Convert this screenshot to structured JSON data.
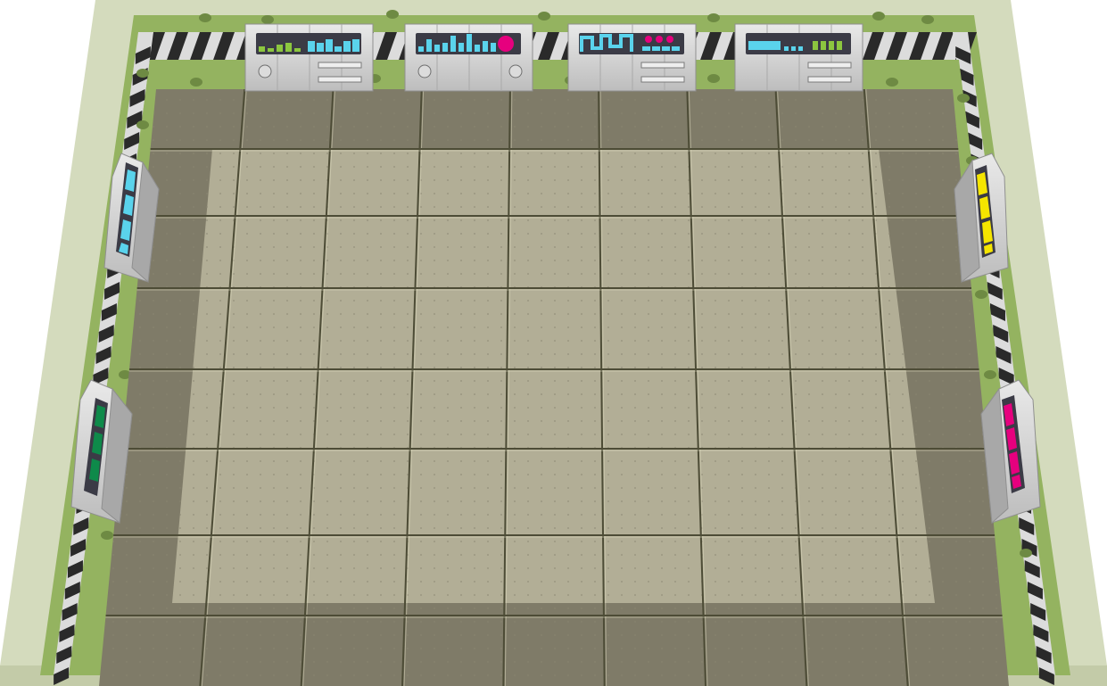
{
  "scene": {
    "kind": "top-down sci-fi game room",
    "grid": {
      "columns": 9,
      "rows": 7
    }
  },
  "colors": {
    "outer_wall": "#d4dbbd",
    "outer_wall_left_face": "#c3cba8",
    "wall_green": "#94b360",
    "wall_green_dark": "#7d9a4d",
    "wall_spot": "#6e8a43",
    "hazard_dark": "#2a2a2a",
    "hazard_light": "#dcdcdc",
    "floor_base": "#b2ae96",
    "floor_shadow": "#7f7b68",
    "floor_line": "#4d4c36",
    "floor_highlight": "#e3e0c3",
    "panel_body": "#d0d0d0",
    "panel_edge": "#8f8f8f",
    "screen_bg": "#3b3b46",
    "accent_green": "#8cc63f",
    "accent_cyan": "#5ad3ec",
    "accent_magenta": "#e6007e",
    "accent_yellow": "#f5e500",
    "accent_dark_green": "#0e8a4a"
  },
  "consoles": [
    {
      "name": "console-top-1",
      "screen": [
        "bars-green",
        "bars-cyan"
      ]
    },
    {
      "name": "console-top-2",
      "screen": [
        "bars-cyan",
        "pie-magenta"
      ]
    },
    {
      "name": "console-top-3",
      "screen": [
        "wave-cyan",
        "dots-magenta"
      ]
    },
    {
      "name": "console-top-4",
      "screen": [
        "block-cyan",
        "bars-green"
      ]
    },
    {
      "name": "console-left-upper",
      "screen": [
        "cells-cyan"
      ]
    },
    {
      "name": "console-left-lower",
      "screen": [
        "cells-dark-green"
      ]
    },
    {
      "name": "console-right-upper",
      "screen": [
        "cells-yellow"
      ]
    },
    {
      "name": "console-right-lower",
      "screen": [
        "cells-magenta"
      ]
    }
  ]
}
